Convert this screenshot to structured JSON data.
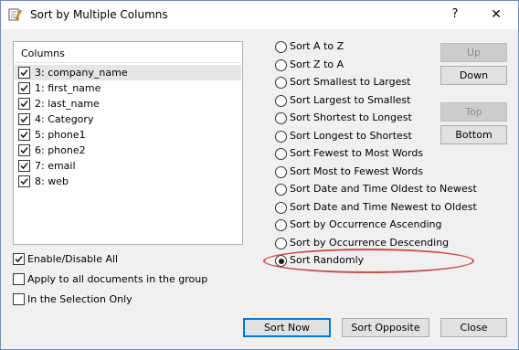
{
  "window": {
    "title": "Sort by Multiple Columns",
    "help_label": "?",
    "close_label": "✕"
  },
  "columns": {
    "header": "Columns",
    "items": [
      {
        "label": "3: company_name",
        "checked": true,
        "selected": true
      },
      {
        "label": "1: first_name",
        "checked": true,
        "selected": false
      },
      {
        "label": "2: last_name",
        "checked": true,
        "selected": false
      },
      {
        "label": "4: Category",
        "checked": true,
        "selected": false
      },
      {
        "label": "5: phone1",
        "checked": true,
        "selected": false
      },
      {
        "label": "6: phone2",
        "checked": true,
        "selected": false
      },
      {
        "label": "7: email",
        "checked": true,
        "selected": false
      },
      {
        "label": "8: web",
        "checked": true,
        "selected": false
      }
    ]
  },
  "options": [
    {
      "label": "Enable/Disable All",
      "checked": true
    },
    {
      "label": "Apply to all documents in the group",
      "checked": false
    },
    {
      "label": "In the Selection Only",
      "checked": false
    }
  ],
  "sort_modes": [
    {
      "label": "Sort A to Z",
      "selected": false
    },
    {
      "label": "Sort Z to A",
      "selected": false
    },
    {
      "label": "Sort Smallest to Largest",
      "selected": false
    },
    {
      "label": "Sort Largest to Smallest",
      "selected": false
    },
    {
      "label": "Sort Shortest to Longest",
      "selected": false
    },
    {
      "label": "Sort Longest to Shortest",
      "selected": false
    },
    {
      "label": "Sort Fewest to Most Words",
      "selected": false
    },
    {
      "label": "Sort Most to Fewest Words",
      "selected": false
    },
    {
      "label": "Sort Date and Time Oldest to Newest",
      "selected": false
    },
    {
      "label": "Sort Date and Time Newest to Oldest",
      "selected": false
    },
    {
      "label": "Sort by Occurrence Ascending",
      "selected": false
    },
    {
      "label": "Sort by Occurrence Descending",
      "selected": false
    },
    {
      "label": "Sort Randomly",
      "selected": true
    }
  ],
  "move_buttons": {
    "up": "Up",
    "down": "Down",
    "top": "Top",
    "bottom": "Bottom"
  },
  "footer_buttons": {
    "sort_now": "Sort Now",
    "sort_opposite": "Sort Opposite",
    "close": "Close"
  },
  "colors": {
    "highlight_ellipse": "#c8504b",
    "default_button_border": "#0078d7"
  }
}
